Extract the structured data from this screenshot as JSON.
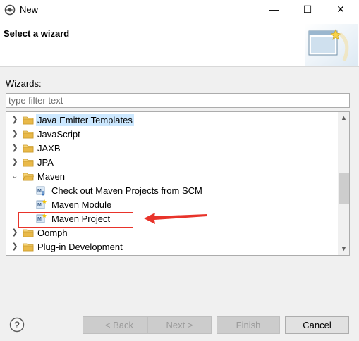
{
  "window": {
    "title": "New",
    "minimize_symbol": "—",
    "maximize_symbol": "☐",
    "close_symbol": "✕"
  },
  "banner": {
    "title": "Select a wizard"
  },
  "wizards": {
    "label": "Wizards:",
    "filter_placeholder": "type filter text"
  },
  "tree": {
    "items": [
      {
        "label": "Java Emitter Templates",
        "icon": "folder-icon",
        "state": "collapsed",
        "selected": true
      },
      {
        "label": "JavaScript",
        "icon": "folder-icon",
        "state": "collapsed"
      },
      {
        "label": "JAXB",
        "icon": "folder-icon",
        "state": "collapsed"
      },
      {
        "label": "JPA",
        "icon": "folder-icon",
        "state": "collapsed"
      },
      {
        "label": "Maven",
        "icon": "folder-icon",
        "state": "expanded"
      },
      {
        "label": "Check out Maven Projects from SCM",
        "icon": "maven-checkout-icon",
        "child": true
      },
      {
        "label": "Maven Module",
        "icon": "maven-module-icon",
        "child": true
      },
      {
        "label": "Maven Project",
        "icon": "maven-project-icon",
        "child": true
      },
      {
        "label": "Oomph",
        "icon": "folder-icon",
        "state": "collapsed"
      },
      {
        "label": "Plug-in Development",
        "icon": "folder-icon",
        "state": "collapsed"
      }
    ]
  },
  "buttons": {
    "help_symbol": "?",
    "back": "< Back",
    "next": "Next >",
    "finish": "Finish",
    "cancel": "Cancel"
  },
  "colors": {
    "selection": "#cce8ff",
    "annotation": "#e8332a",
    "folder": "#e9b949"
  }
}
